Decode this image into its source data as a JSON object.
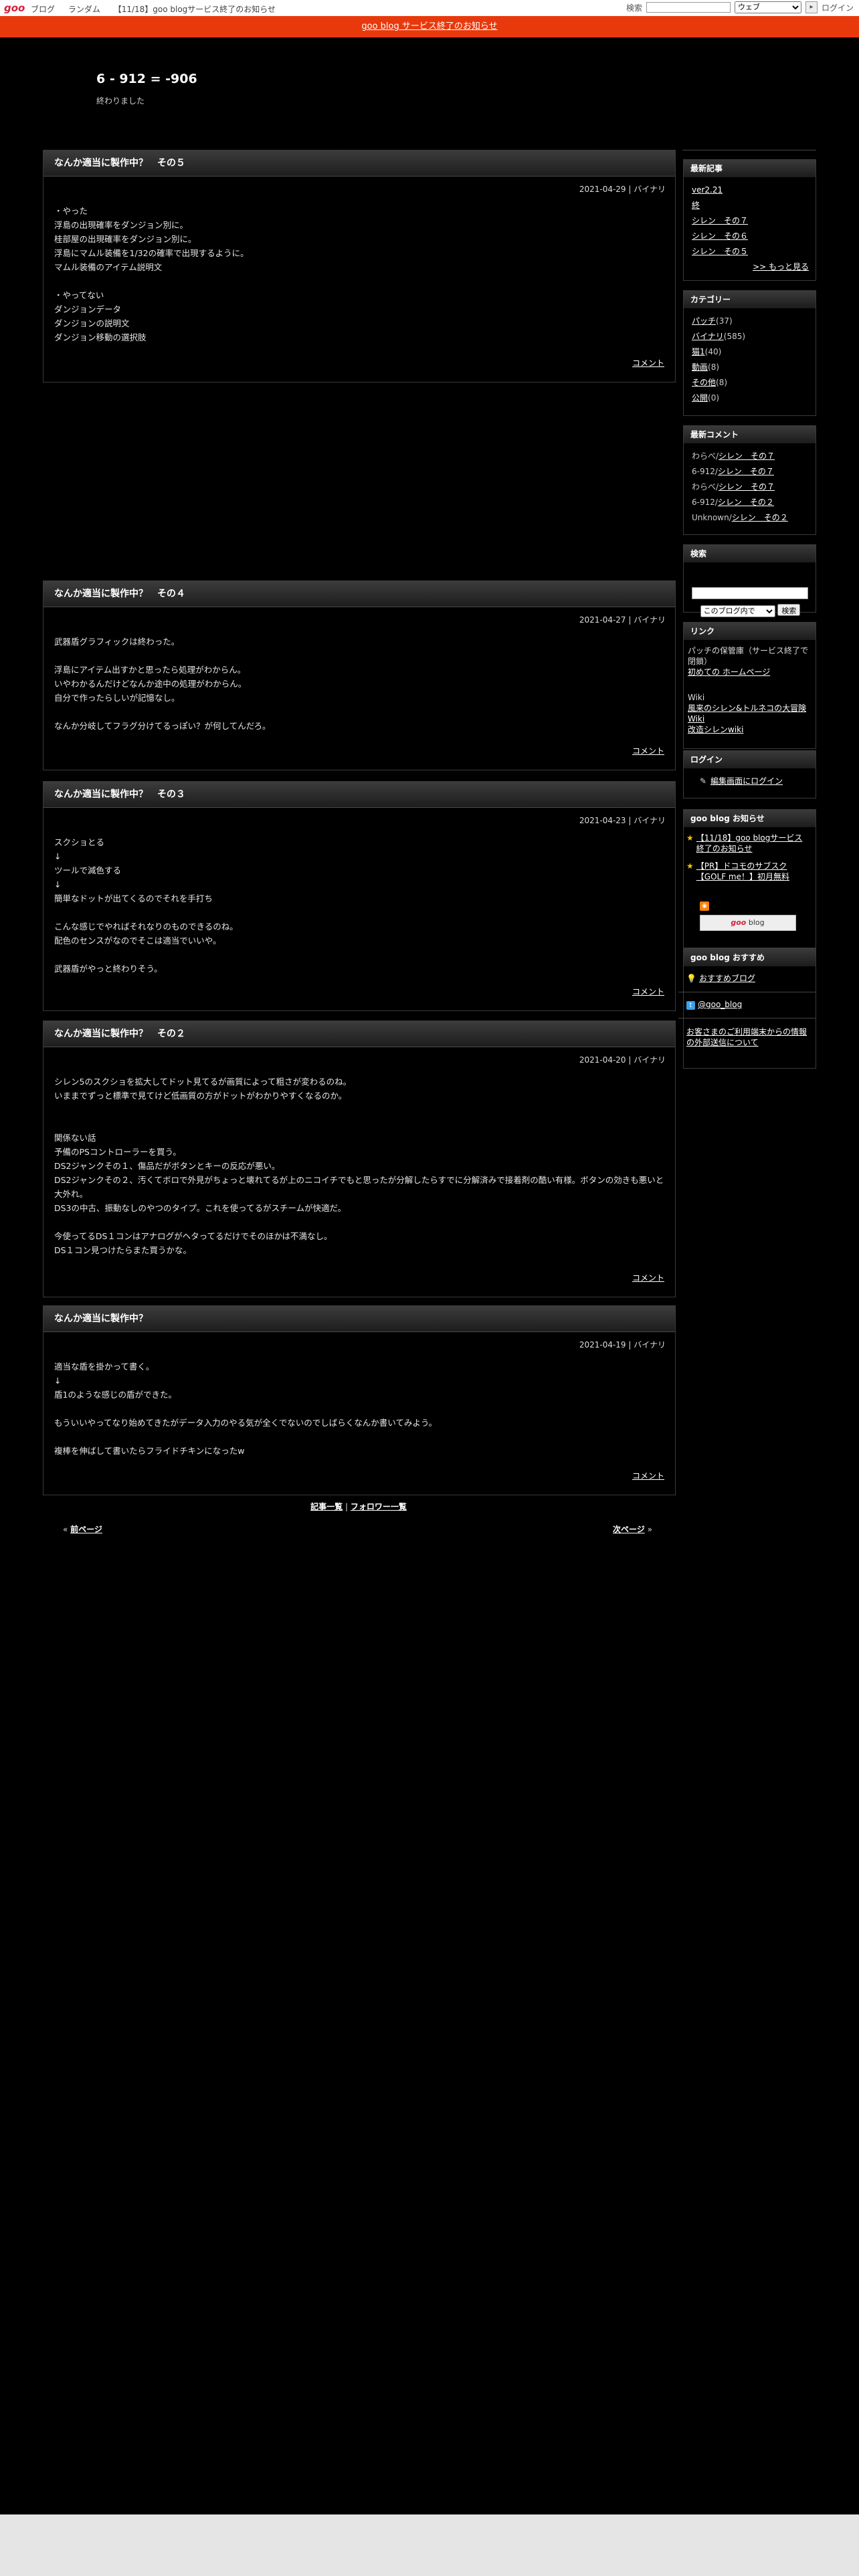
{
  "topbar": {
    "logo": "goo",
    "nav": [
      "ブログ",
      "ランダム",
      "【11/18】goo blogサービス終了のお知らせ"
    ],
    "search_label": "検索",
    "search_placeholder": "",
    "search_scope": "ウェブ",
    "login": "ログイン"
  },
  "notice": "goo blog サービス終了のお知らせ",
  "site": {
    "title": "6 - 912 = -906",
    "description": "終わりました"
  },
  "entries": [
    {
      "title": "なんか適当に製作中？　その５",
      "meta": "2021-04-29 | バイナリ",
      "body": "・やった\n浮島の出現確率をダンジョン別に。\n桂部屋の出現確率をダンジョン別に。\n浮島にマムル装備を1/32の確率で出現するように。\nマムル装備のアイテム説明文\n\n・やってない\nダンジョンデータ\nダンジョンの説明文\nダンジョン移動の選択肢",
      "comment": "コメント"
    },
    {
      "title": "なんか適当に製作中？　その４",
      "meta": "2021-04-27 | バイナリ",
      "body": "武器盾グラフィックは終わった。\n\n浮島にアイテム出すかと思ったら処理がわからん。\nいやわかるんだけどなんか途中の処理がわからん。\n自分で作ったらしいが記憶なし。\n\nなんか分岐してフラグ分けてるっぽい？が何してんだろ。",
      "comment": "コメント"
    },
    {
      "title": "なんか適当に製作中？　その３",
      "meta": "2021-04-23 | バイナリ",
      "body": "スクショとる\n↓\nツールで減色する\n↓\n簡単なドットが出てくるのでそれを手打ち\n\nこんな感じでやればそれなりのものできるのね。\n配色のセンスがなのでそこは適当でいいや。\n\n武器盾がやっと終わりそう。",
      "comment": "コメント"
    },
    {
      "title": "なんか適当に製作中？　その２",
      "meta": "2021-04-20 | バイナリ",
      "body": "シレン5のスクショを拡大してドット見てるが画質によって粗さが変わるのね。\nいままでずっと標準で見てけど低画質の方がドットがわかりやすくなるのか。\n\n\n関係ない話\n予備のPSコントローラーを買う。\nDS2ジャンクその１、傷品だがボタンとキーの反応が悪い。\nDS2ジャンクその２、汚くてボロで外見がちょっと壊れてるが上のニコイチでもと思ったが分解したらすでに分解済みで接着剤の酷い有様。ボタンの効きも悪いと大外れ。\nDS3の中古、振動なしのやつのタイプ。これを使ってるがスチームが快適だ。\n\n今使ってるDS１コンはアナログがヘタってるだけでそのほかは不満なし。\nDS１コン見つけたらまた買うかな。",
      "comment": "コメント"
    },
    {
      "title": "なんか適当に製作中？",
      "meta": "2021-04-19 | バイナリ",
      "body": "適当な盾を掛かって書く。\n↓\n盾1のような感じの盾ができた。\n\nもういいやってなり始めてきたがデータ入力のやる気が全くでないのでしばらくなんか書いてみよう。\n\n複棒を伸ばして書いたらフライドチキンになったw",
      "comment": "コメント"
    }
  ],
  "entry_nav": {
    "list": "記事一覧",
    "sep": "|",
    "follow": "フォロワー一覧",
    "prev": "前ページ",
    "prev_mark": "«",
    "next": "次ページ",
    "next_mark": "»"
  },
  "sidebar": {
    "recent": {
      "title": "最新記事",
      "items": [
        "ver2.21",
        "終",
        "シレン　その７",
        "シレン　その６",
        "シレン　その５"
      ],
      "more": ">> もっと見る"
    },
    "categories": {
      "title": "カテゴリー",
      "items": [
        {
          "name": "パッチ",
          "count": "(37)"
        },
        {
          "name": "バイナリ",
          "count": "(585)"
        },
        {
          "name": "猫1",
          "count": "(40)"
        },
        {
          "name": "動画",
          "count": "(8)"
        },
        {
          "name": "その他",
          "count": "(8)"
        },
        {
          "name": "公開",
          "count": "(0)"
        }
      ]
    },
    "comments": {
      "title": "最新コメント",
      "items": [
        {
          "author": "わらべ/",
          "link": "シレン　その７"
        },
        {
          "author": "6-912/",
          "link": "シレン　その７"
        },
        {
          "author": "わらべ/",
          "link": "シレン　その７"
        },
        {
          "author": "6-912/",
          "link": "シレン　その２"
        },
        {
          "author": "Unknown/",
          "link": "シレン　その２"
        }
      ]
    },
    "search": {
      "title": "検索",
      "scope": "このブログ内で",
      "button": "検索"
    },
    "links": {
      "title": "リンク",
      "note": "パッチの保管庫（サービス終了で閉鎖）",
      "homepage": "初めての ホームページ",
      "wiki_label": "Wiki",
      "wiki1": "風来のシレン&トルネコの大冒険 Wiki",
      "wiki2": "改造シレンwiki"
    },
    "login": {
      "title": "ログイン",
      "link": "編集画面にログイン"
    },
    "goo_notice": {
      "title": "goo blog お知らせ",
      "items": [
        "【11/18】goo blogサービス終了のお知らせ",
        "【PR】ドコモのサブスク【GOLF me！】初月無料"
      ]
    },
    "badge": {
      "goo": "goo",
      "blog": "blog"
    },
    "recommend": {
      "title": "goo blog おすすめ",
      "link": "おすすめブログ",
      "twitter": "@goo_blog",
      "info": "お客さまのご利用端末からの情報の外部送信について"
    }
  },
  "colors": {
    "notice_bg": "#e8390c",
    "page_bg": "#000000",
    "footer_bg": "#e5e5e5"
  }
}
